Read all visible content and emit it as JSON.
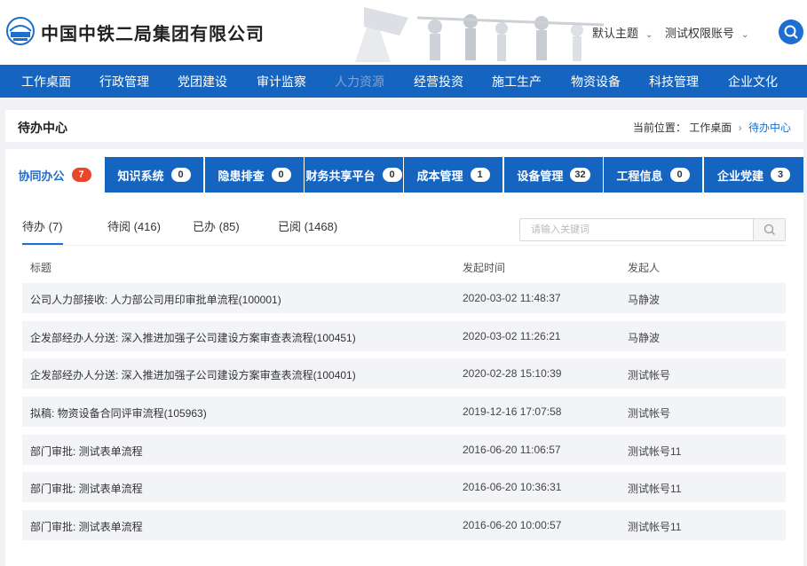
{
  "header": {
    "company_name": "中国中铁二局集团有限公司",
    "theme_label": "默认主题",
    "account_label": "测试权限账号"
  },
  "nav": {
    "items": [
      "工作桌面",
      "行政管理",
      "党团建设",
      "审计监察",
      "人力资源",
      "经营投资",
      "施工生产",
      "物资设备",
      "科技管理",
      "企业文化"
    ]
  },
  "breadcrumb": {
    "title": "待办中心",
    "prefix": "当前位置：",
    "parent": "工作桌面",
    "current": "待办中心"
  },
  "tabs": [
    {
      "label": "协同办公",
      "count": "7"
    },
    {
      "label": "知识系统",
      "count": "0"
    },
    {
      "label": "隐患排查",
      "count": "0"
    },
    {
      "label": "财务共享平台",
      "count": "0"
    },
    {
      "label": "成本管理",
      "count": "1"
    },
    {
      "label": "设备管理",
      "count": "32"
    },
    {
      "label": "工程信息",
      "count": "0"
    },
    {
      "label": "企业党建",
      "count": "3"
    }
  ],
  "subtabs": [
    "待办 (7)",
    "待阅 (416)",
    "已办 (85)",
    "已阅 (1468)"
  ],
  "search": {
    "placeholder": "请输入关键词"
  },
  "table": {
    "headers": [
      "标题",
      "发起时间",
      "发起人"
    ],
    "rows": [
      {
        "title": "公司人力部接收: 人力部公司用印审批单流程(100001)",
        "time": "2020-03-02 11:48:37",
        "user": "马静波"
      },
      {
        "title": "企发部经办人分送: 深入推进加强子公司建设方案审查表流程(100451)",
        "time": "2020-03-02 11:26:21",
        "user": "马静波"
      },
      {
        "title": "企发部经办人分送: 深入推进加强子公司建设方案审查表流程(100401)",
        "time": "2020-02-28 15:10:39",
        "user": "测试帐号"
      },
      {
        "title": "拟稿: 物资设备合同评审流程(105963)",
        "time": "2019-12-16 17:07:58",
        "user": "测试帐号"
      },
      {
        "title": "部门审批: 测试表单流程",
        "time": "2016-06-20 11:06:57",
        "user": "测试帐号11"
      },
      {
        "title": "部门审批: 测试表单流程",
        "time": "2016-06-20 10:36:31",
        "user": "测试帐号11"
      },
      {
        "title": "部门审批: 测试表单流程",
        "time": "2016-06-20 10:00:57",
        "user": "测试帐号11"
      }
    ]
  },
  "colors": {
    "primary": "#1565c0",
    "accent": "#1a6fd1",
    "badge_active": "#e8472b"
  },
  "icons": [
    "company-logo-icon",
    "chevron-down-icon",
    "search-icon"
  ]
}
